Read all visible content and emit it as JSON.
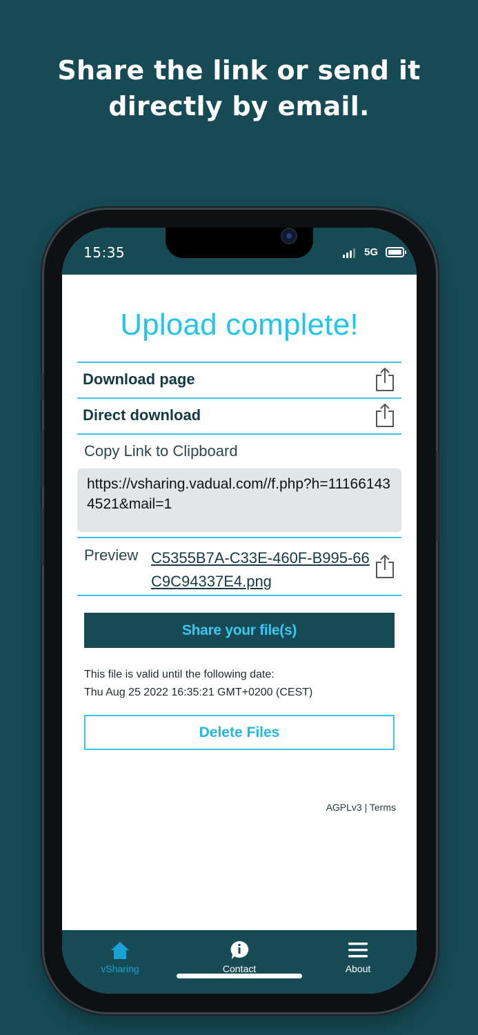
{
  "promo": {
    "headline_line1": "Share the link or send it",
    "headline_line2": "directly by email."
  },
  "status_bar": {
    "time": "15:35",
    "network": "5G"
  },
  "upload": {
    "title": "Upload complete!",
    "download_page_label": "Download page",
    "direct_download_label": "Direct download",
    "copy_link_label": "Copy Link to Clipboard",
    "link_url": "https://vsharing.vadual.com//f.php?h=111661434521&mail=1",
    "preview_label": "Preview",
    "preview_filename": "C5355B7A-C33E-460F-B995-66C9C94337E4.png",
    "share_button_label": "Share your file(s)",
    "validity_text": "This file is valid until the following date:",
    "validity_date": "Thu Aug 25 2022 16:35:21 GMT+0200 (CEST)",
    "delete_button_label": "Delete Files",
    "footer": "AGPLv3 | Terms"
  },
  "tabbar": {
    "items": [
      {
        "label": "vSharing",
        "icon": "home-icon",
        "active": true
      },
      {
        "label": "Contact",
        "icon": "info-bubble-icon",
        "active": false
      },
      {
        "label": "About",
        "icon": "hamburger-menu-icon",
        "active": false
      }
    ]
  },
  "colors": {
    "background": "#164a55",
    "accent": "#22c4e9",
    "text_dark": "#133a45"
  }
}
